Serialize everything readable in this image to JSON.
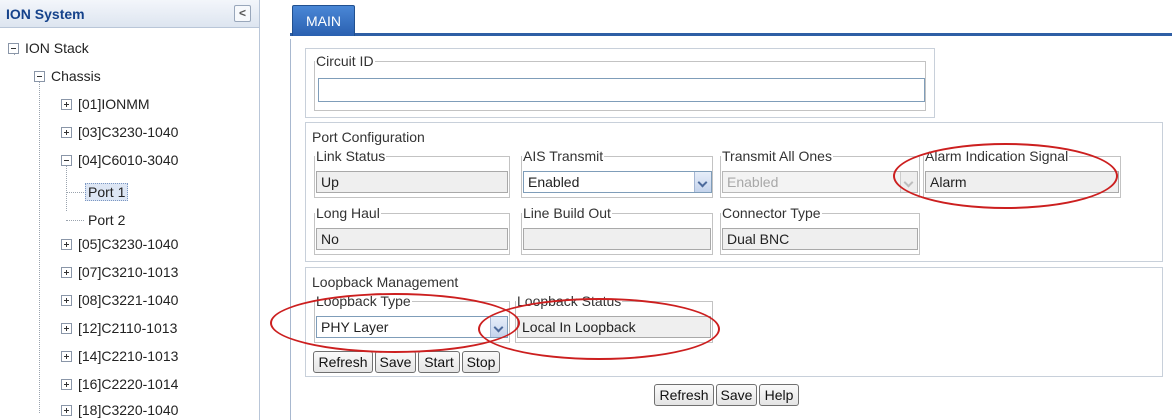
{
  "tree": {
    "title": "ION System",
    "collapse_glyph": "<",
    "nodes": [
      {
        "label": "ION Stack"
      },
      {
        "label": "Chassis"
      },
      {
        "label": "[01]IONMM"
      },
      {
        "label": "[03]C3230-1040"
      },
      {
        "label": "[04]C6010-3040"
      },
      {
        "label": "Port 1"
      },
      {
        "label": "Port 2"
      },
      {
        "label": "[05]C3230-1040"
      },
      {
        "label": "[07]C3210-1013"
      },
      {
        "label": "[08]C3221-1040"
      },
      {
        "label": "[12]C2110-1013"
      },
      {
        "label": "[14]C2210-1013"
      },
      {
        "label": "[16]C2220-1014"
      },
      {
        "label": "[18]C3220-1040"
      }
    ],
    "selected": "Port 1"
  },
  "tabs": {
    "main": "MAIN"
  },
  "circuit": {
    "legend": "Circuit ID",
    "value": ""
  },
  "port_config": {
    "title": "Port Configuration",
    "link_status": {
      "legend": "Link Status",
      "value": "Up"
    },
    "ais_transmit": {
      "legend": "AIS Transmit",
      "value": "Enabled"
    },
    "transmit_all_ones": {
      "legend": "Transmit All Ones",
      "value": "Enabled"
    },
    "alarm_indication": {
      "legend": "Alarm Indication Signal",
      "value": "Alarm"
    },
    "long_haul": {
      "legend": "Long Haul",
      "value": "No"
    },
    "line_build_out": {
      "legend": "Line Build Out",
      "value": ""
    },
    "connector_type": {
      "legend": "Connector Type",
      "value": "Dual BNC"
    }
  },
  "loopback": {
    "title": "Loopback Management",
    "type": {
      "legend": "Loopback Type",
      "value": "PHY Layer"
    },
    "status": {
      "legend": "Loopback Status",
      "value": "Local In Loopback"
    },
    "buttons": {
      "refresh": "Refresh",
      "save": "Save",
      "start": "Start",
      "stop": "Stop"
    }
  },
  "footer_buttons": {
    "refresh": "Refresh",
    "save": "Save",
    "help": "Help"
  },
  "icons": {
    "tree_expand": "plus-box-icon",
    "tree_collapse": "minus-box-icon",
    "dropdown": "chevron-down-icon"
  },
  "colors": {
    "tab_blue": "#2a60b0",
    "annotation_red": "#cc1f1f",
    "selected_bg": "#dde6f4"
  }
}
